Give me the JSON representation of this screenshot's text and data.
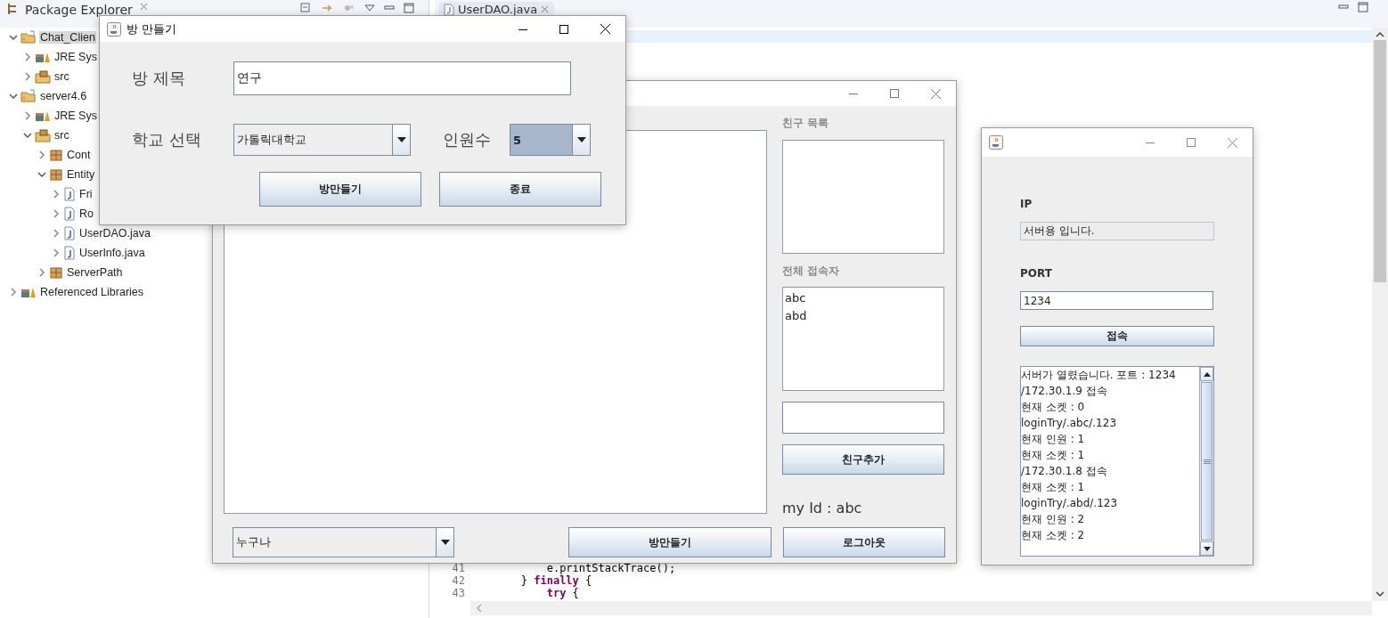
{
  "ide": {
    "explorer": {
      "title": "Package Explorer",
      "tree": [
        {
          "label": "Chat_Clien",
          "kind": "project",
          "expanded": true,
          "selected": true,
          "children": [
            {
              "label": "JRE Sys",
              "kind": "library",
              "expanded": false,
              "selected": false
            },
            {
              "label": "src",
              "kind": "source",
              "expanded": false,
              "selected": false
            }
          ]
        },
        {
          "label": "server4.6",
          "kind": "project",
          "expanded": true,
          "selected": false,
          "children": [
            {
              "label": "JRE Sys",
              "kind": "library",
              "expanded": false,
              "selected": false
            },
            {
              "label": "src",
              "kind": "source",
              "expanded": true,
              "selected": false,
              "children": [
                {
                  "label": "Cont",
                  "kind": "package",
                  "expanded": false,
                  "selected": false
                },
                {
                  "label": "Entity",
                  "kind": "package",
                  "expanded": true,
                  "selected": false,
                  "children": [
                    {
                      "label": "Fri",
                      "kind": "file",
                      "expanded": false,
                      "selected": false
                    },
                    {
                      "label": "Ro",
                      "kind": "file",
                      "expanded": false,
                      "selected": false
                    },
                    {
                      "label": "UserDAO.java",
                      "kind": "file",
                      "expanded": false,
                      "selected": false
                    },
                    {
                      "label": "UserInfo.java",
                      "kind": "file",
                      "expanded": false,
                      "selected": false
                    }
                  ]
                },
                {
                  "label": "ServerPath",
                  "kind": "package",
                  "expanded": false,
                  "selected": false
                }
              ]
            }
          ]
        },
        {
          "label": "Referenced Libraries",
          "kind": "library",
          "expanded": false,
          "selected": false
        }
      ]
    },
    "editor": {
      "tab": {
        "label": "UserDAO.java",
        "selected": true
      },
      "code_lines": [
        {
          "number": "41",
          "text": "            e.printStackTrace();"
        },
        {
          "number": "42",
          "text": "        } **finally** {"
        },
        {
          "number": "43",
          "text": "            **try** {"
        }
      ]
    }
  },
  "chat_window": {
    "friends_label": "친구 목록",
    "users_label": "전체 접속자",
    "users": [
      "abc",
      "abd"
    ],
    "add_friend_button": "친구추가",
    "my_id": "my Id : abc",
    "target_combo": {
      "value": "누구나",
      "highlighted": false
    },
    "create_room_button": "방만들기",
    "logout_button": "로그아웃"
  },
  "server_window": {
    "ip_label": "IP",
    "ip_value": "서버용 입니다.",
    "port_label": "PORT",
    "port_value": "1234",
    "connect_button": "접속",
    "log": [
      "서버가 열렸습니다. 포트 : 1234",
      "/172.30.1.9 접속",
      "현재 소켓 : 0",
      "loginTry/.abc/.123",
      "현재 인원 : 1",
      "현재 소켓 : 1",
      "/172.30.1.8 접속",
      "현재 소켓 : 1",
      "loginTry/.abd/.123",
      "현재 인원 : 2",
      "현재 소켓 : 2"
    ]
  },
  "room_dialog": {
    "title": "방 만들기",
    "name_label": "방 제목",
    "name_value": "연구",
    "school_label": "학교 선택",
    "school_combo": {
      "value": "가톨릭대학교",
      "highlighted": false
    },
    "count_label": "인원수",
    "count_combo": {
      "value": "5",
      "highlighted": true
    },
    "create_button": "방만들기",
    "close_button": "종료"
  }
}
